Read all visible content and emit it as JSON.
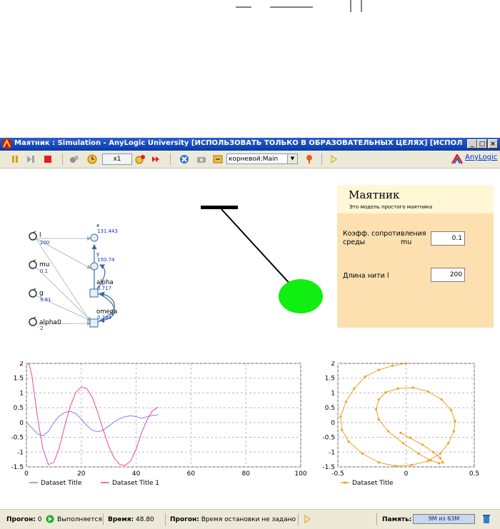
{
  "window": {
    "title": "Маятник : Simulation - AnyLogic University  [ИСПОЛЬЗОВАТЬ ТОЛЬКО В ОБРАЗОВАТЕЛЬНЫХ ЦЕЛЯХ] [ИСПОЛЬЗОВАТЬ ТОЛЬКО ...",
    "minimize": "_",
    "maximize": "□",
    "close": "×"
  },
  "toolbar": {
    "speed": "x1",
    "experiment": "корневой:Main",
    "anylogic_link": "AnyLogic"
  },
  "model_vars": {
    "l": {
      "name": "l",
      "value": "200"
    },
    "mu": {
      "name": "mu",
      "value": "0.1"
    },
    "g": {
      "name": "g",
      "value": "9.81"
    },
    "alpha0": {
      "name": "alpha0",
      "value": "2"
    },
    "x": {
      "name": "x",
      "value": "131.443"
    },
    "y": {
      "name": "y",
      "value": "150.74"
    },
    "alpha": {
      "name": "alpha",
      "value": "0.717"
    },
    "omega": {
      "name": "omega",
      "value": "0.204"
    }
  },
  "panel": {
    "title": "Маятник",
    "subtitle": "Это модель простого маятника",
    "mu_label_line1": "Коэфф. сопротивления",
    "mu_label_line2": "среды",
    "mu_label_var": "mu",
    "mu_value": "0.1",
    "l_label": "Длина нити  l",
    "l_value": "200"
  },
  "colors": {
    "bob": "#11ee11",
    "series1": "#8080ee",
    "series2": "#ee44aa",
    "phase": "#f0a020",
    "panel_head": "#fff7d6",
    "panel_body": "#fde0b0"
  },
  "chart_data": [
    {
      "type": "line",
      "xlim": [
        0,
        100
      ],
      "ylim": [
        -1.5,
        2
      ],
      "x_ticks": [
        "0",
        "20",
        "40",
        "60",
        "80",
        "100"
      ],
      "y_ticks": [
        "2",
        "1.5",
        "1",
        "0.5",
        "0",
        "-0.5",
        "-1",
        "-1.5"
      ],
      "grid": true,
      "legend_position": "bottom-left",
      "series": [
        {
          "name": "Dataset Title",
          "x": [
            0,
            2,
            4,
            6,
            8,
            10,
            12,
            14,
            16,
            18,
            20,
            22,
            24,
            26,
            28,
            30,
            32,
            34,
            36,
            38,
            40,
            42,
            44,
            46,
            48
          ],
          "y": [
            0,
            -0.18,
            -0.38,
            -0.45,
            -0.3,
            0,
            0.22,
            0.34,
            0.38,
            0.3,
            0.12,
            -0.1,
            -0.26,
            -0.31,
            -0.26,
            -0.12,
            0.02,
            0.13,
            0.2,
            0.23,
            0.2,
            0.14,
            0.2,
            0.24,
            0.26
          ]
        },
        {
          "name": "Dataset Title 1",
          "x": [
            0,
            1,
            2,
            3,
            4,
            6,
            8,
            10,
            12,
            14,
            16,
            18,
            20,
            22,
            24,
            26,
            28,
            30,
            32,
            34,
            36,
            38,
            40,
            42,
            44,
            46,
            48
          ],
          "y": [
            2,
            1.95,
            1.6,
            0.9,
            0.2,
            -0.9,
            -1.42,
            -1.35,
            -0.85,
            -0.1,
            0.55,
            1.02,
            1.2,
            1.15,
            0.85,
            0.35,
            -0.25,
            -0.8,
            -1.2,
            -1.42,
            -1.45,
            -1.3,
            -0.9,
            -0.35,
            0.1,
            0.4,
            0.52
          ]
        }
      ]
    },
    {
      "type": "scatter",
      "xlim": [
        -0.5,
        0.5
      ],
      "ylim": [
        -1.5,
        2
      ],
      "x_ticks": [
        "-0.5",
        "0",
        "0.5"
      ],
      "y_ticks": [
        "2",
        "1.5",
        "1",
        "0.5",
        "0",
        "-0.5",
        "-1",
        "-1.5"
      ],
      "grid": true,
      "legend_position": "bottom-left",
      "series": [
        {
          "name": "Dataset Title",
          "x": [
            0.0,
            -0.1,
            -0.2,
            -0.3,
            -0.38,
            -0.44,
            -0.48,
            -0.47,
            -0.42,
            -0.32,
            -0.2,
            -0.08,
            0.04,
            0.16,
            0.25,
            0.31,
            0.35,
            0.36,
            0.33,
            0.26,
            0.16,
            0.05,
            -0.06,
            -0.15,
            -0.2,
            -0.22,
            -0.2,
            -0.13,
            -0.02,
            0.09,
            0.18,
            0.24,
            0.27,
            0.25,
            0.2,
            0.12,
            0.03,
            -0.04
          ],
          "y": [
            2.0,
            1.92,
            1.78,
            1.55,
            1.15,
            0.7,
            0.2,
            -0.25,
            -0.65,
            -1.05,
            -1.35,
            -1.47,
            -1.44,
            -1.3,
            -1.05,
            -0.7,
            -0.3,
            0.05,
            0.42,
            0.78,
            1.05,
            1.18,
            1.15,
            1.02,
            0.78,
            0.45,
            0.1,
            -0.3,
            -0.7,
            -1.05,
            -1.28,
            -1.38,
            -1.35,
            -1.2,
            -1.0,
            -0.75,
            -0.52,
            -0.35
          ]
        }
      ]
    }
  ]
}
